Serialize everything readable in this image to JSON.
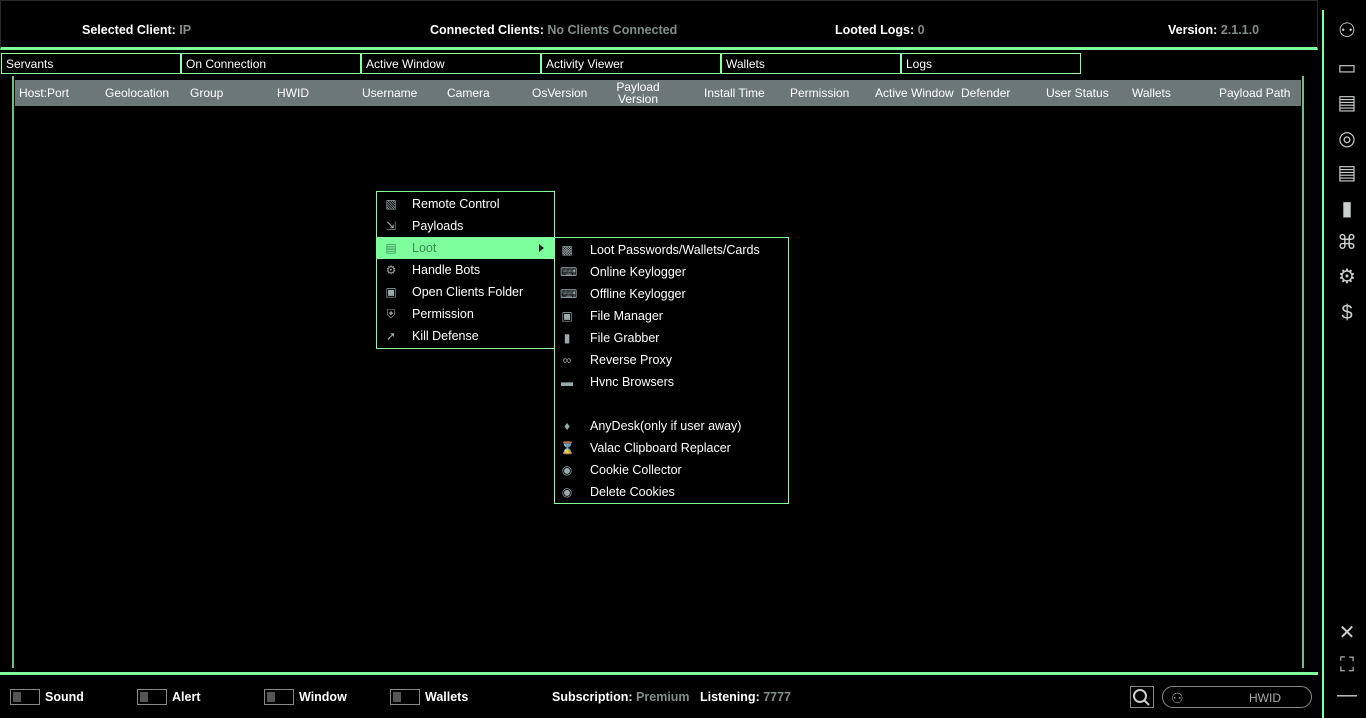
{
  "topbar": {
    "selected_client_label": "Selected Client",
    "selected_client_value": "IP",
    "connected_label": "Connected Clients",
    "connected_value": "No Clients Connected",
    "looted_label": "Looted Logs",
    "looted_value": "0",
    "version_label": "Version",
    "version_value": "2.1.1.0"
  },
  "tabs": [
    "Servants",
    "On Connection",
    "Active Window",
    "Activity Viewer",
    "Wallets",
    "Logs"
  ],
  "columns": [
    "Host:Port",
    "Geolocation",
    "Group",
    "HWID",
    "Username",
    "Camera",
    "OsVersion",
    "Payload Version",
    "Install Time",
    "Permission",
    "Active Window",
    "Defender",
    "User Status",
    "Wallets",
    "Payload Path"
  ],
  "menu": {
    "items": [
      {
        "label": "Remote Control",
        "icon": "phone-icon"
      },
      {
        "label": "Payloads",
        "icon": "payload-icon"
      },
      {
        "label": "Loot",
        "icon": "loot-icon",
        "active": true,
        "submenu": true
      },
      {
        "label": "Handle Bots",
        "icon": "gears-icon"
      },
      {
        "label": "Open Clients Folder",
        "icon": "folder-icon"
      },
      {
        "label": "Permission",
        "icon": "shield-icon"
      },
      {
        "label": "Kill Defense",
        "icon": "syringe-icon"
      }
    ]
  },
  "submenu": {
    "items": [
      {
        "label": "Loot Passwords/Wallets/Cards",
        "icon": "id-card-icon"
      },
      {
        "label": "Online Keylogger",
        "icon": "keyboard-icon"
      },
      {
        "label": "Offline Keylogger",
        "icon": "keyboard-icon"
      },
      {
        "label": "File Manager",
        "icon": "folder-icon"
      },
      {
        "label": "File Grabber",
        "icon": "grabber-icon"
      },
      {
        "label": "Reverse Proxy",
        "icon": "share-icon"
      },
      {
        "label": "Hvnc Browsers",
        "icon": "browser-icon"
      },
      {
        "label": "",
        "icon": ""
      },
      {
        "label": "AnyDesk(only if user away)",
        "icon": "anydesk-icon"
      },
      {
        "label": "Valac Clipboard Replacer",
        "icon": "clipboard-icon"
      },
      {
        "label": "Cookie Collector",
        "icon": "cookie-icon"
      },
      {
        "label": "Delete Cookies",
        "icon": "cookie-icon"
      }
    ]
  },
  "bottombar": {
    "toggles": [
      "Sound",
      "Alert",
      "Window",
      "Wallets"
    ],
    "subscription_label": "Subscription",
    "subscription_value": "Premium",
    "listening_label": "Listening",
    "listening_value": "7777",
    "search_placeholder": "HWID"
  },
  "sidebar_icons": [
    "user-icon",
    "monitor-icon",
    "activity-icon",
    "eye-icon",
    "notepad-icon",
    "archive-icon",
    "wifi-icon",
    "gears-icon",
    "dollar-icon",
    "close-icon",
    "fullscreen-icon",
    "minimize-icon"
  ]
}
